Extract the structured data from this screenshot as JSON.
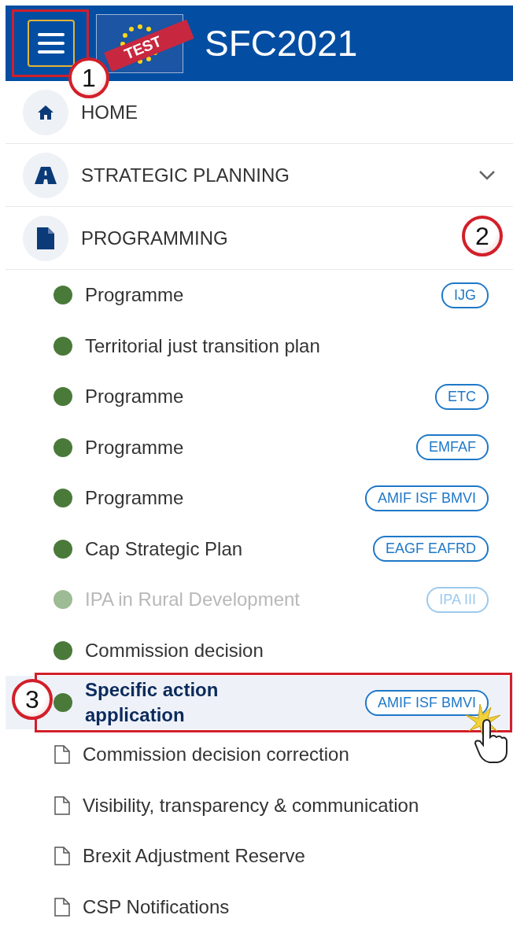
{
  "header": {
    "title": "SFC2021",
    "logo_badge": "TEST"
  },
  "annotations": [
    {
      "label": "1",
      "kind": "menu"
    },
    {
      "label": "2",
      "kind": "section"
    },
    {
      "label": "3",
      "kind": "item"
    }
  ],
  "sections": [
    {
      "label": "HOME",
      "kind": "home",
      "collapsed": false
    },
    {
      "label": "STRATEGIC PLANNING",
      "kind": "road",
      "collapsed": true
    },
    {
      "label": "PROGRAMMING",
      "kind": "document"
    }
  ],
  "items": [
    {
      "label": "Programme",
      "kind": "dot",
      "tag": "IJG",
      "disabled": false,
      "selected": false
    },
    {
      "label": "Territorial just transition plan",
      "kind": "dot",
      "disabled": false,
      "selected": false
    },
    {
      "label": "Programme",
      "kind": "dot",
      "tag": "ETC",
      "disabled": false,
      "selected": false
    },
    {
      "label": "Programme",
      "kind": "dot",
      "tag": "EMFAF",
      "disabled": false,
      "selected": false
    },
    {
      "label": "Programme",
      "kind": "dot",
      "tag": "AMIF ISF BMVI",
      "disabled": false,
      "selected": false
    },
    {
      "label": "Cap Strategic Plan",
      "kind": "dot",
      "tag": "EAGF EAFRD",
      "disabled": false,
      "selected": false
    },
    {
      "label": "IPA in Rural Development",
      "kind": "dot",
      "tag": "IPA III",
      "disabled": true,
      "selected": false
    },
    {
      "label": "Commission decision",
      "kind": "dot",
      "disabled": false,
      "selected": false
    },
    {
      "label": "Specific action application",
      "kind": "dot",
      "tag": "AMIF ISF BMVI",
      "disabled": false,
      "selected": true
    },
    {
      "label": "Commission decision correction",
      "kind": "page",
      "disabled": false,
      "selected": false
    },
    {
      "label": "Visibility, transparency & communication",
      "kind": "page",
      "disabled": false,
      "selected": false
    },
    {
      "label": "Brexit Adjustment Reserve",
      "kind": "page",
      "disabled": false,
      "selected": false
    },
    {
      "label": "CSP Notifications",
      "kind": "page",
      "disabled": false,
      "selected": false
    }
  ]
}
